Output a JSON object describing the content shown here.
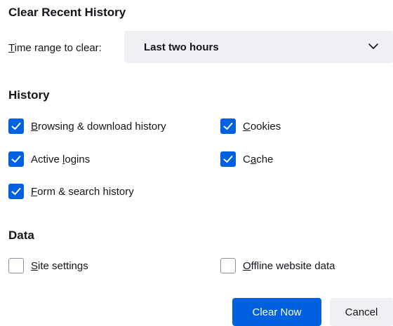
{
  "dialog": {
    "title": "Clear Recent History",
    "time_range_label": "Time range to clear:",
    "time_range_value": "Last two hours",
    "sections": {
      "history": {
        "heading": "History",
        "items": {
          "browsing": {
            "label": "Browsing & download history",
            "checked": true
          },
          "cookies": {
            "label": "Cookies",
            "checked": true
          },
          "logins": {
            "label": "Active logins",
            "checked": true
          },
          "cache": {
            "label": "Cache",
            "checked": true
          },
          "forms": {
            "label": "Form & search history",
            "checked": true
          }
        }
      },
      "data": {
        "heading": "Data",
        "items": {
          "site_settings": {
            "label": "Site settings",
            "checked": false
          },
          "offline": {
            "label": "Offline website data",
            "checked": false
          }
        }
      }
    },
    "buttons": {
      "clear_now": "Clear Now",
      "cancel": "Cancel"
    }
  },
  "colors": {
    "accent": "#0061e0",
    "select_background": "#f0f0f4",
    "text": "#15141a"
  },
  "icons": {
    "checkmark": "checkmark-icon",
    "dropdown": "chevron-down-icon"
  }
}
